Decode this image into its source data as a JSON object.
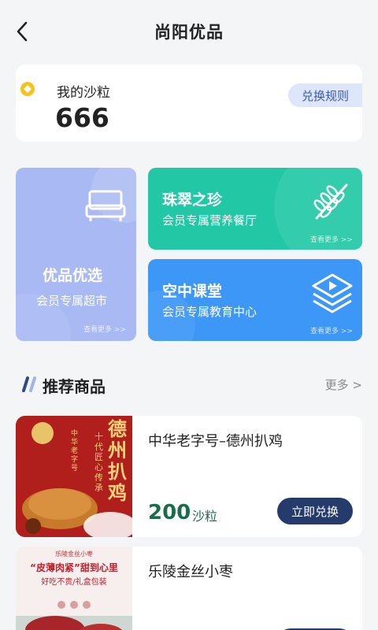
{
  "header": {
    "title": "尚阳优品"
  },
  "points": {
    "label": "我的沙粒",
    "value": "666",
    "rules_label": "兑换规则"
  },
  "tiles": {
    "market": {
      "title": "优品优选",
      "subtitle": "会员专属超市",
      "more": "查看更多 >>"
    },
    "jade": {
      "title": "珠翠之珍",
      "subtitle": "会员专属营养餐厅",
      "more": "查看更多 >>"
    },
    "classroom": {
      "title": "空中课堂",
      "subtitle": "会员专属教育中心",
      "more": "查看更多 >>"
    }
  },
  "recommend": {
    "title": "推荐商品",
    "more": "更多 >"
  },
  "products": [
    {
      "name": "中华老字号–德州扒鸡",
      "price": "200",
      "unit": "沙粒",
      "button": "立即兑换",
      "image_text": {
        "brand": "德州扒鸡",
        "slogan": "十代匠心传承",
        "tag": "中华老字号"
      }
    },
    {
      "name": "乐陵金丝小枣",
      "image_text": {
        "top": "乐陵金丝小枣",
        "headline": "“皮薄肉紧”甜到心里",
        "sub": "好吃不贵/礼盒包装"
      }
    }
  ],
  "colors": {
    "accent": "#253b6b",
    "price": "#1b6b4d",
    "tile_market": "#a9b9f3",
    "tile_jade": "#22c8a5",
    "tile_class": "#3d97f7",
    "coin": "#f6c21c"
  }
}
